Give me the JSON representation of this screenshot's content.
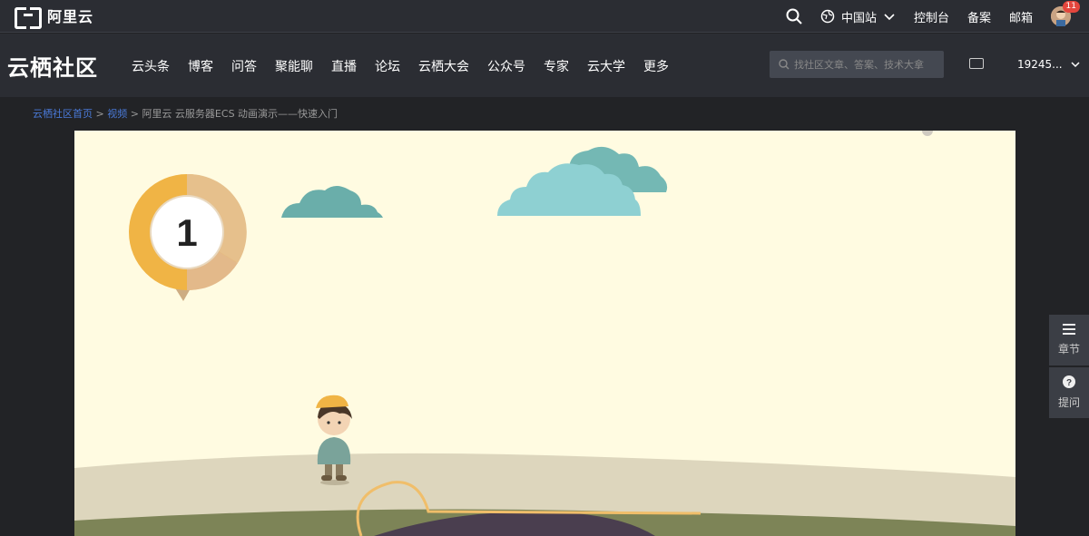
{
  "topbar": {
    "logo_text": "阿里云",
    "region": "中国站",
    "console": "控制台",
    "record": "备案",
    "mail": "邮箱",
    "badge": "11"
  },
  "navbar": {
    "brand": "云栖社区",
    "menu": [
      "云头条",
      "博客",
      "问答",
      "聚能聊",
      "直播",
      "论坛",
      "云栖大会",
      "公众号",
      "专家",
      "云大学",
      "更多"
    ],
    "search_placeholder": "找社区文章、答案、技术大拿",
    "user": "19245..."
  },
  "breadcrumb": {
    "home": "云栖社区首页",
    "sep1": " > ",
    "video": "视频",
    "sep2": " > ",
    "current": "阿里云 云服务器ECS 动画演示——快速入门"
  },
  "video": {
    "step_number": "1"
  },
  "side": {
    "chapters": "章节",
    "ask": "提问"
  },
  "colors": {
    "bg": "#222326",
    "bar": "#2b2d33",
    "link": "#4a7ad9",
    "video_bg": "#fffbe1"
  }
}
